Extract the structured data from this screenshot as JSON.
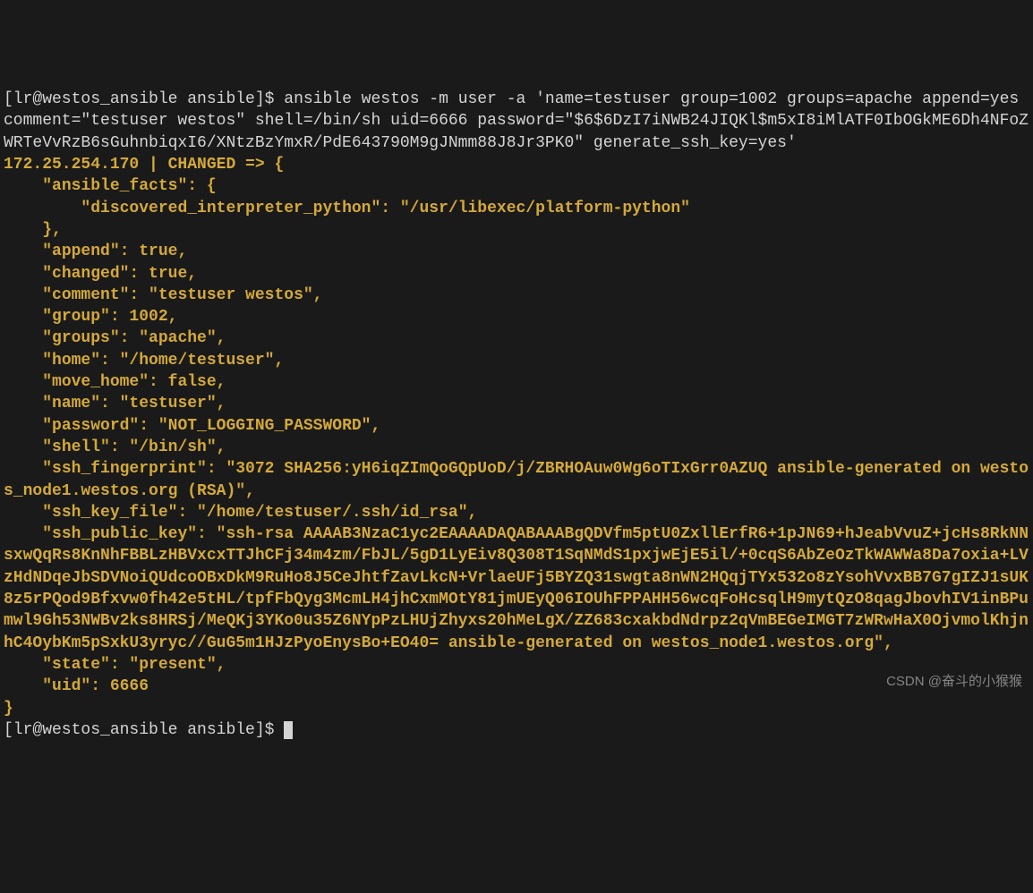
{
  "prompt1": "[lr@westos_ansible ansible]$ ",
  "command": "ansible westos -m user -a 'name=testuser group=1002 groups=apache append=yes comment=\"testuser westos\" shell=/bin/sh uid=6666 password=\"$6$6DzI7iNWB24JIQKl$m5xI8iMlATF0IbOGkME6Dh4NFoZWRTeVvRzB6sGuhnbiqxI6/XNtzBzYmxR/PdE643790M9gJNmm88J8Jr3PK0\" generate_ssh_key=yes'",
  "host_line": "172.25.254.170 | CHANGED => {",
  "json_lines": [
    "    \"ansible_facts\": {",
    "        \"discovered_interpreter_python\": \"/usr/libexec/platform-python\"",
    "    },",
    "    \"append\": true,",
    "    \"changed\": true,",
    "    \"comment\": \"testuser westos\",",
    "    \"group\": 1002,",
    "    \"groups\": \"apache\",",
    "    \"home\": \"/home/testuser\",",
    "    \"move_home\": false,",
    "    \"name\": \"testuser\",",
    "    \"password\": \"NOT_LOGGING_PASSWORD\",",
    "    \"shell\": \"/bin/sh\",",
    "    \"ssh_fingerprint\": \"3072 SHA256:yH6iqZImQoGQpUoD/j/ZBRHOAuw0Wg6oTIxGrr0AZUQ ansible-generated on westos_node1.westos.org (RSA)\",",
    "    \"ssh_key_file\": \"/home/testuser/.ssh/id_rsa\",",
    "    \"ssh_public_key\": \"ssh-rsa AAAAB3NzaC1yc2EAAAADAQABAAABgQDVfm5ptU0ZxllErfR6+1pJN69+hJeabVvuZ+jcHs8RkNNsxwQqRs8KnNhFBBLzHBVxcxTTJhCFj34m4zm/FbJL/5gD1LyEiv8Q308T1SqNMdS1pxjwEjE5il/+0cqS6AbZeOzTkWAWWa8Da7oxia+LVzHdNDqeJbSDVNoiQUdcoOBxDkM9RuHo8J5CeJhtfZavLkcN+VrlaeUFj5BYZQ31swgta8nWN2HQqjTYx532o8zYsohVvxBB7G7gIZJ1sUK8z5rPQod9Bfxvw0fh42e5tHL/tpfFbQyg3McmLH4jhCxmMOtY81jmUEyQ06IOUhFPPAHH56wcqFoHcsqlH9mytQzO8qagJbovhIV1inBPumwl9Gh53NWBv2ks8HRSj/MeQKj3YKo0u35Z6NYpPzLHUjZhyxs20hMeLgX/ZZ683cxakbdNdrpz2qVmBEGeIMGT7zWRwHaX0OjvmolKhjnhC4OybKm5pSxkU3yryc//GuG5m1HJzPyoEnysBo+EO40= ansible-generated on westos_node1.westos.org\",",
    "    \"state\": \"present\",",
    "    \"uid\": 6666",
    "}"
  ],
  "prompt2": "[lr@westos_ansible ansible]$ ",
  "watermark": "CSDN @奋斗的小猴猴"
}
